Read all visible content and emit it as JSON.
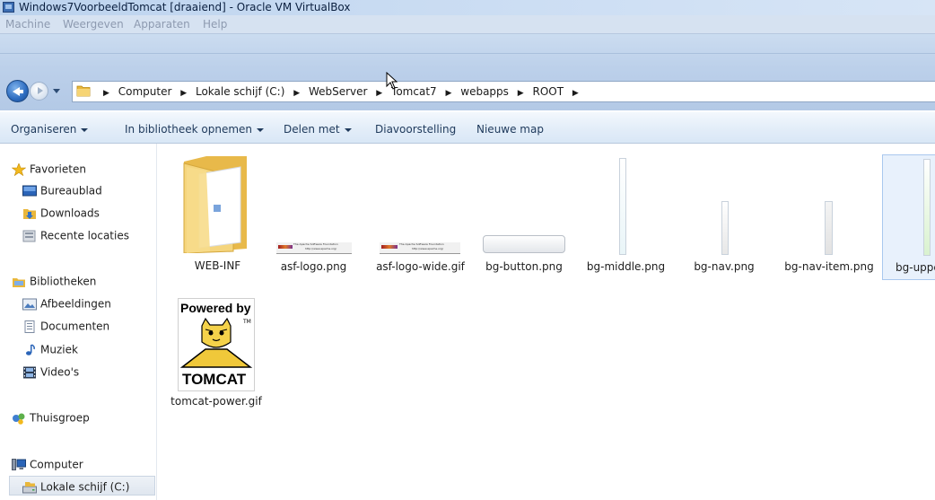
{
  "vbox": {
    "title": "Windows7VoorbeeldTomcat [draaiend] - Oracle VM VirtualBox",
    "menu": [
      "Machine",
      "Weergeven",
      "Apparaten",
      "Help"
    ]
  },
  "address": {
    "crumbs": [
      "Computer",
      "Lokale schijf (C:)",
      "WebServer",
      "Tomcat7",
      "webapps",
      "ROOT"
    ]
  },
  "commands": {
    "organize": "Organiseren",
    "include": "In bibliotheek opnemen",
    "share": "Delen met",
    "slideshow": "Diavoorstelling",
    "new_folder": "Nieuwe map"
  },
  "nav": {
    "favorites": "Favorieten",
    "desktop": "Bureaublad",
    "downloads": "Downloads",
    "recent": "Recente locaties",
    "libraries": "Bibliotheken",
    "pictures": "Afbeeldingen",
    "documents": "Documenten",
    "music": "Muziek",
    "videos": "Video's",
    "homegroup": "Thuisgroep",
    "computer": "Computer",
    "local_disk": "Lokale schijf (C:)"
  },
  "files": {
    "webinf": "WEB-INF",
    "asf_logo": "asf-logo.png",
    "asf_logo_wide": "asf-logo-wide.gif",
    "bg_button": "bg-button.png",
    "bg_middle": "bg-middle.png",
    "bg_nav": "bg-nav.png",
    "bg_nav_item": "bg-nav-item.png",
    "bg_upper": "bg-uppe",
    "tomcat_power": "tomcat-power.gif"
  },
  "thumbnails": {
    "powered_by": "Powered by",
    "tm": "TM",
    "tomcat": "TOMCAT",
    "asf_text": "The Apache Software Foundation",
    "asf_url": "http://www.apache.org/"
  },
  "colors": {
    "accent": "#1e395b",
    "folder": "#f2cf6b",
    "glass": "#bcd0ea"
  }
}
